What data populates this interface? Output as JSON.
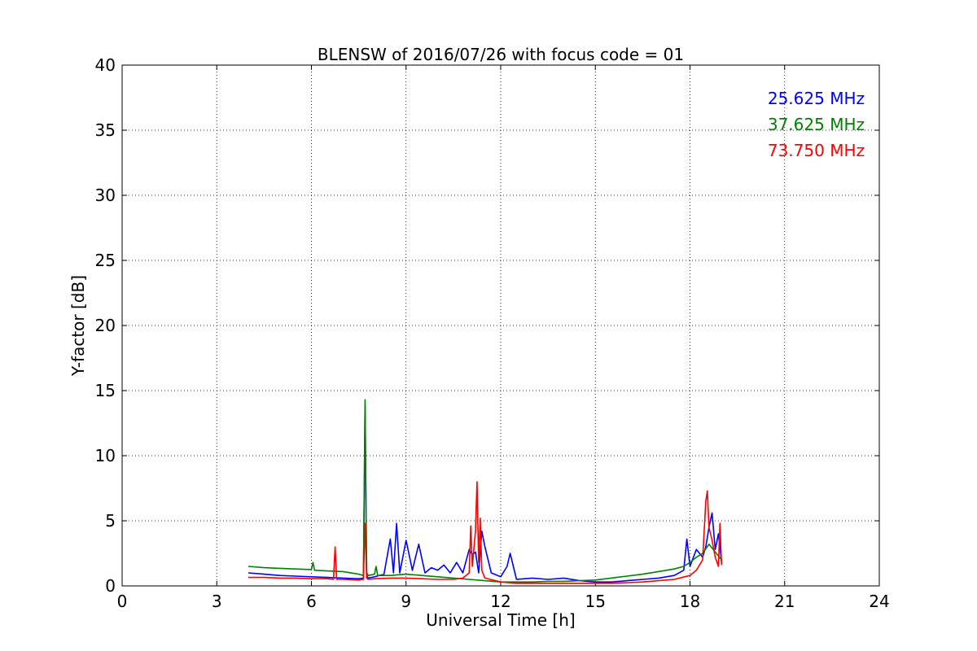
{
  "chart_data": {
    "type": "line",
    "title": "BLENSW of 2016/07/26 with focus code = 01",
    "xlabel": "Universal Time [h]",
    "ylabel": "Y-factor [dB]",
    "xlim": [
      0,
      24
    ],
    "ylim": [
      0,
      40
    ],
    "xticks": [
      0,
      3,
      6,
      9,
      12,
      15,
      18,
      21,
      24
    ],
    "yticks": [
      0,
      5,
      10,
      15,
      20,
      25,
      30,
      35,
      40
    ],
    "grid": true,
    "grid_style": "dotted",
    "legend_placement": "top-right",
    "series": [
      {
        "name": "25.625 MHz",
        "color": "#0000ff",
        "x": [
          4.0,
          4.5,
          5.0,
          5.5,
          6.0,
          6.5,
          7.0,
          7.5,
          7.65,
          7.7,
          7.75,
          7.8,
          8.0,
          8.3,
          8.5,
          8.6,
          8.7,
          8.8,
          9.0,
          9.2,
          9.4,
          9.6,
          9.8,
          10.0,
          10.2,
          10.4,
          10.6,
          10.8,
          11.0,
          11.1,
          11.2,
          11.3,
          11.4,
          11.5,
          11.7,
          12.0,
          12.2,
          12.3,
          12.5,
          13.0,
          13.5,
          14.0,
          14.5,
          15.0,
          15.5,
          16.0,
          16.5,
          17.0,
          17.5,
          17.8,
          17.9,
          18.0,
          18.2,
          18.4,
          18.5,
          18.6,
          18.7,
          18.8,
          18.9,
          19.0
        ],
        "y": [
          1.0,
          0.9,
          0.8,
          0.75,
          0.7,
          0.65,
          0.6,
          0.55,
          0.6,
          13.9,
          0.8,
          0.6,
          0.7,
          0.9,
          3.6,
          1.0,
          4.8,
          1.0,
          3.5,
          1.2,
          3.2,
          1.0,
          1.4,
          1.2,
          1.6,
          1.0,
          1.8,
          1.0,
          2.8,
          2.4,
          2.6,
          1.0,
          4.2,
          3.0,
          1.0,
          0.7,
          1.5,
          2.5,
          0.5,
          0.6,
          0.5,
          0.6,
          0.4,
          0.3,
          0.3,
          0.4,
          0.5,
          0.6,
          0.8,
          1.2,
          3.6,
          1.5,
          2.8,
          2.2,
          3.0,
          4.5,
          5.6,
          2.8,
          4.0,
          1.8
        ]
      },
      {
        "name": "37.625 MHz",
        "color": "#008000",
        "x": [
          4.0,
          4.5,
          5.0,
          5.5,
          6.0,
          6.05,
          6.1,
          6.5,
          7.0,
          7.5,
          7.65,
          7.7,
          7.75,
          7.8,
          8.0,
          8.05,
          8.1,
          8.5,
          9.0,
          9.5,
          10.0,
          10.5,
          11.0,
          11.5,
          12.0,
          12.5,
          13.0,
          13.5,
          14.0,
          14.5,
          15.0,
          15.5,
          16.0,
          16.5,
          17.0,
          17.5,
          17.8,
          18.0,
          18.2,
          18.4,
          18.6,
          18.8,
          19.0
        ],
        "y": [
          1.5,
          1.4,
          1.35,
          1.3,
          1.25,
          1.8,
          1.2,
          1.15,
          1.1,
          0.9,
          0.8,
          14.3,
          1.0,
          0.8,
          0.9,
          1.5,
          0.8,
          0.8,
          0.9,
          0.8,
          0.7,
          0.6,
          0.5,
          0.4,
          0.3,
          0.3,
          0.3,
          0.35,
          0.35,
          0.4,
          0.45,
          0.6,
          0.75,
          0.9,
          1.1,
          1.3,
          1.5,
          1.8,
          2.2,
          2.5,
          3.2,
          2.6,
          2.0
        ]
      },
      {
        "name": "73.750 MHz",
        "color": "#ff0000",
        "x": [
          4.0,
          4.5,
          5.0,
          5.5,
          6.0,
          6.5,
          6.7,
          6.75,
          6.8,
          7.0,
          7.5,
          7.65,
          7.7,
          7.75,
          7.8,
          8.0,
          8.5,
          9.0,
          9.5,
          10.0,
          10.5,
          10.8,
          11.0,
          11.05,
          11.1,
          11.2,
          11.25,
          11.3,
          11.35,
          11.4,
          11.5,
          12.0,
          12.5,
          13.0,
          13.5,
          14.0,
          14.5,
          15.0,
          15.5,
          16.0,
          16.5,
          17.0,
          17.5,
          18.0,
          18.2,
          18.4,
          18.5,
          18.55,
          18.6,
          18.7,
          18.8,
          18.9,
          18.95,
          19.0
        ],
        "y": [
          0.65,
          0.65,
          0.6,
          0.6,
          0.55,
          0.55,
          0.5,
          3.0,
          0.5,
          0.5,
          0.45,
          0.5,
          4.8,
          0.6,
          0.5,
          0.55,
          0.6,
          0.6,
          0.55,
          0.5,
          0.5,
          0.6,
          1.0,
          4.6,
          1.5,
          4.2,
          8.0,
          1.8,
          5.2,
          1.2,
          0.6,
          0.3,
          0.2,
          0.2,
          0.2,
          0.2,
          0.2,
          0.2,
          0.2,
          0.25,
          0.3,
          0.4,
          0.5,
          0.8,
          1.2,
          2.0,
          6.5,
          7.3,
          4.5,
          3.5,
          2.2,
          1.5,
          4.8,
          1.6
        ]
      }
    ]
  }
}
